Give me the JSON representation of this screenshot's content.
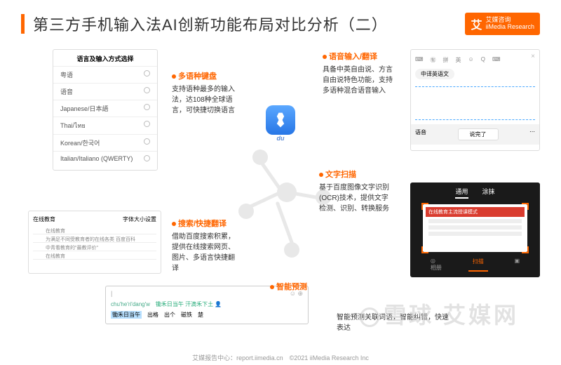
{
  "header": {
    "title": "第三方手机输入法AI创新功能布局对比分析（二）",
    "logo_cn": "艾媒咨询",
    "logo_en": "iiMedia Research"
  },
  "center": {
    "brand": "du"
  },
  "features": {
    "multilang": {
      "title": "多语种键盘",
      "desc": "支持语种最多的输入法，达108种全球语言，可快捷切换语言"
    },
    "search": {
      "title": "搜索/快捷翻译",
      "desc": "借助百度搜索积累，提供在线搜索网页、图片、多语言快捷翻译"
    },
    "voice": {
      "title": "语音输入/翻译",
      "desc": "具备中英自由说、方言自由说特色功能，支持多语种混合语音输入"
    },
    "ocr": {
      "title": "文字扫描",
      "desc": "基于百度图像文字识别(OCR)技术，提供文字检测、识别、转换服务"
    },
    "predict": {
      "title": "智能预测",
      "desc": "智能预测关联词语，智能纠错，快速表达"
    }
  },
  "lang_panel": {
    "header": "语言及输入方式选择",
    "items": [
      "粤语",
      "语音",
      "Japanese/日本語",
      "Thai/ไทย",
      "Korean/한국어",
      "Italian/Italiano (QWERTY)"
    ]
  },
  "search_panel": {
    "tab1": "在线教育",
    "tab2": "字体大小设置",
    "l1": "在线教育",
    "l2": "为满足不同受教育者的在线各类 百度百科",
    "l3": "中青看教育的\"最教评价\"",
    "l4": "在线教育"
  },
  "voice_panel": {
    "tabs": [
      "⌨",
      "㊒",
      "拼",
      "英",
      "☺",
      "Q",
      "⌨"
    ],
    "pill": "中译英语文",
    "left_btn": "语音",
    "done": "说完了"
  },
  "ocr_panel": {
    "tab1": "通用",
    "tab2": "涂抹",
    "banner": "在线教育主流授课模式",
    "cam": "相册",
    "scan": "扫描"
  },
  "pred_panel": {
    "pinyin": "chu'he'ri'dang'w",
    "suggestion": "锄禾日当午 汗滴禾下土",
    "candidates": [
      "锄禾日当午",
      "出格",
      "出个",
      "磁铁",
      "楚"
    ]
  },
  "watermark": "雪球 艾媒网",
  "footer": "艾媒报告中心：report.iimedia.cn　©2021 iiMedia Research Inc"
}
